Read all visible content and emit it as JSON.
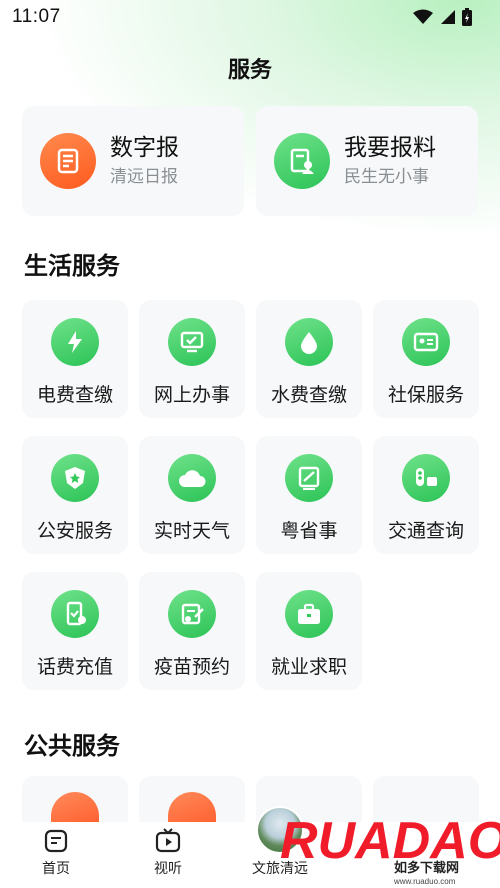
{
  "status_bar": {
    "time": "11:07"
  },
  "page": {
    "title": "服务"
  },
  "top_cards": [
    {
      "title": "数字报",
      "subtitle": "清远日报",
      "icon": "newspaper-icon",
      "color": "#ff6a2e"
    },
    {
      "title": "我要报料",
      "subtitle": "民生无小事",
      "icon": "report-icon",
      "color": "#34c759"
    }
  ],
  "sections": {
    "life": {
      "title": "生活服务",
      "items": [
        {
          "label": "电费查缴",
          "icon": "electricity-icon"
        },
        {
          "label": "网上办事",
          "icon": "online-service-icon"
        },
        {
          "label": "水费查缴",
          "icon": "water-icon"
        },
        {
          "label": "社保服务",
          "icon": "social-security-card-icon"
        },
        {
          "label": "公安服务",
          "icon": "police-badge-icon"
        },
        {
          "label": "实时天气",
          "icon": "cloud-icon"
        },
        {
          "label": "粤省事",
          "icon": "yue-app-icon"
        },
        {
          "label": "交通查询",
          "icon": "traffic-icon"
        },
        {
          "label": "话费充值",
          "icon": "phone-recharge-icon"
        },
        {
          "label": "疫苗预约",
          "icon": "vaccine-icon"
        },
        {
          "label": "就业求职",
          "icon": "briefcase-icon"
        }
      ]
    },
    "public": {
      "title": "公共服务"
    }
  },
  "bottom_nav": [
    {
      "label": "首页",
      "icon": "home-icon"
    },
    {
      "label": "视听",
      "icon": "tv-icon"
    },
    {
      "label": "文旅清远",
      "icon": "scenery-thumbnail"
    }
  ],
  "watermark": {
    "brand": "RUADAO",
    "sub": "如多下载网",
    "url": "www.ruaduo.com"
  },
  "colors": {
    "accent_green": "#34c759",
    "accent_orange": "#ff6a2e",
    "card_bg": "#f6f8f9"
  }
}
